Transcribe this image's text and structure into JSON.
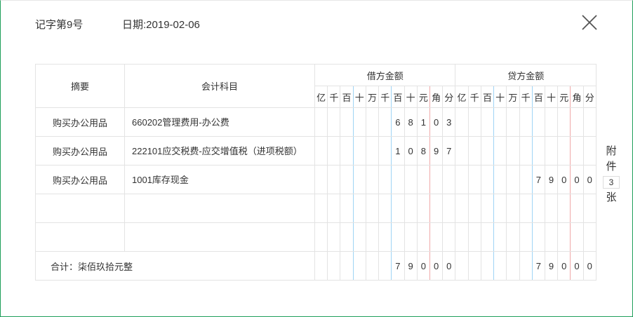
{
  "header": {
    "voucher_no": "记字第9号",
    "date": "日期:2019-02-06"
  },
  "table": {
    "col_summary": "摘要",
    "col_account": "会计科目",
    "col_debit": "借方金额",
    "col_credit": "贷方金额",
    "units": [
      "亿",
      "千",
      "百",
      "十",
      "万",
      "千",
      "百",
      "十",
      "元",
      "角",
      "分"
    ],
    "rows": [
      {
        "summary": "购买办公用品",
        "account": "660202管理费用-办公费",
        "debit": "68103",
        "credit": ""
      },
      {
        "summary": "购买办公用品",
        "account": "222101应交税费-应交增值税（进项税额）",
        "debit": "10897",
        "credit": ""
      },
      {
        "summary": "购买办公用品",
        "account": "1001库存现金",
        "debit": "",
        "credit": "79000"
      },
      {
        "summary": "",
        "account": "",
        "debit": "",
        "credit": ""
      },
      {
        "summary": "",
        "account": "",
        "debit": "",
        "credit": ""
      }
    ],
    "total": {
      "label": "合计：柒佰玖拾元整",
      "debit": "79000",
      "credit": "79000"
    }
  },
  "attachment": {
    "label_top": "附",
    "label_mid": "件",
    "count": "3",
    "label_bottom": "张"
  },
  "colors": {
    "border": "#1e9e5a",
    "blue_line": "#9fd4f5",
    "red_line": "#f0a9a9"
  }
}
